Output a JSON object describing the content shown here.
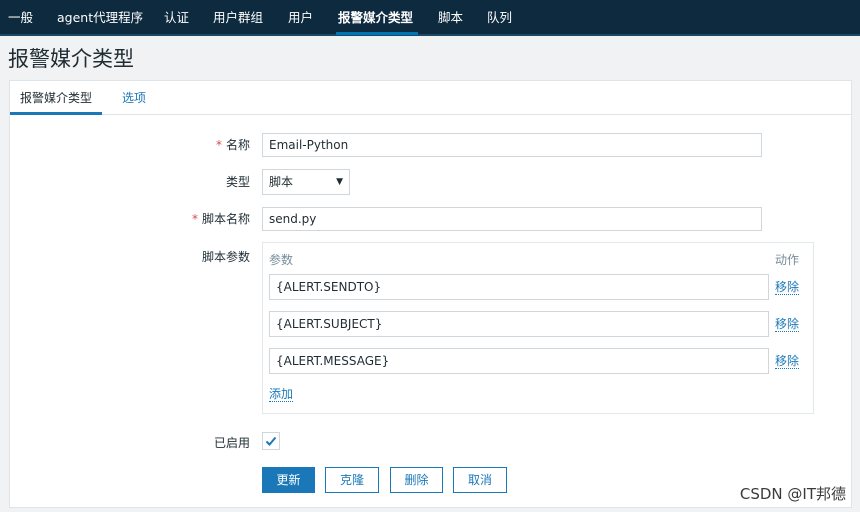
{
  "nav": {
    "items": [
      "一般",
      "agent代理程序",
      "认证",
      "用户群组",
      "用户",
      "报警媒介类型",
      "脚本",
      "队列"
    ],
    "active_index": 5
  },
  "page": {
    "title": "报警媒介类型"
  },
  "tabs": {
    "active": "报警媒介类型",
    "options": "选项"
  },
  "form": {
    "name_label": "名称",
    "name_value": "Email-Python",
    "type_label": "类型",
    "type_value": "脚本",
    "script_name_label": "脚本名称",
    "script_name_value": "send.py",
    "script_params_label": "脚本参数",
    "params_header": "参数",
    "action_header": "动作",
    "params": [
      "{ALERT.SENDTO}",
      "{ALERT.SUBJECT}",
      "{ALERT.MESSAGE}"
    ],
    "remove_label": "移除",
    "add_label": "添加",
    "enabled_label": "已启用",
    "enabled": true,
    "required_mark": "*"
  },
  "buttons": {
    "update": "更新",
    "clone": "克隆",
    "delete": "删除",
    "cancel": "取消"
  },
  "watermark": "CSDN @IT邦德",
  "colors": {
    "nav_bg": "#0d2a3e",
    "accent": "#1b78b8",
    "required": "#d64e4e"
  }
}
